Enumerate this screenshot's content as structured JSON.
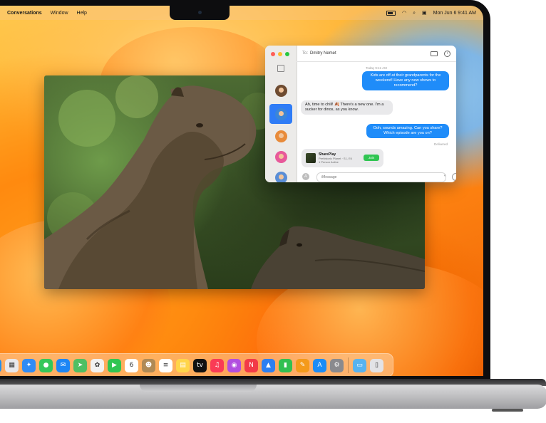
{
  "menubar": {
    "items": [
      "Conversations",
      "Window",
      "Help"
    ],
    "status": {
      "datetime": "Mon Jun 6  9:41 AM"
    }
  },
  "messages": {
    "to_label": "To:",
    "recipient": "Dmitry Nemet",
    "timestamp": "Today 9:41 AM",
    "bubbles": [
      {
        "dir": "out",
        "text": "Kids are off at their grandparents for the weekend! Have any new shows to recommend?"
      },
      {
        "dir": "in",
        "text": "Ah, time to chill! 🍂 There's a new one. I'm a sucker for dinos, as you know."
      },
      {
        "dir": "out",
        "text": "Ooh, sounds amazing. Can you share? Which episode are you on?"
      }
    ],
    "delivered": "Delivered",
    "shareplay": {
      "title": "SharePlay",
      "subtitle": "Prehistoric Planet  ·  S1, E6",
      "subtitle2": "1 Person Active",
      "join_label": "Join"
    },
    "input_placeholder": "iMessage"
  },
  "dock": {
    "apps": [
      {
        "name": "Finder",
        "color": "#1e8ff0",
        "glyph": "☺"
      },
      {
        "name": "Launchpad",
        "color": "#e8e8ec",
        "glyph": "▦"
      },
      {
        "name": "Safari",
        "color": "#2f8bf5",
        "glyph": "✦"
      },
      {
        "name": "Messages",
        "color": "#34c759",
        "glyph": "●"
      },
      {
        "name": "Mail",
        "color": "#1d86f5",
        "glyph": "✉"
      },
      {
        "name": "Maps",
        "color": "#4fbf63",
        "glyph": "➤"
      },
      {
        "name": "Photos",
        "color": "#f2f2f2",
        "glyph": "✿"
      },
      {
        "name": "FaceTime",
        "color": "#30c552",
        "glyph": "▶"
      },
      {
        "name": "Calendar",
        "color": "#ffffff",
        "glyph": "6"
      },
      {
        "name": "Contacts",
        "color": "#b08a55",
        "glyph": "☻"
      },
      {
        "name": "Reminders",
        "color": "#ffffff",
        "glyph": "≡"
      },
      {
        "name": "Notes",
        "color": "#ffd54a",
        "glyph": "▤"
      },
      {
        "name": "TV",
        "color": "#111111",
        "glyph": "tv"
      },
      {
        "name": "Music",
        "color": "#fa3b55",
        "glyph": "♫"
      },
      {
        "name": "Podcasts",
        "color": "#b24ee0",
        "glyph": "◉"
      },
      {
        "name": "News",
        "color": "#f23a48",
        "glyph": "N"
      },
      {
        "name": "Keynote",
        "color": "#2d7ff2",
        "glyph": "▲"
      },
      {
        "name": "Numbers",
        "color": "#31c051",
        "glyph": "▮"
      },
      {
        "name": "Pages",
        "color": "#f49a1b",
        "glyph": "✎"
      },
      {
        "name": "App Store",
        "color": "#1b8cf6",
        "glyph": "A"
      },
      {
        "name": "System Settings",
        "color": "#8a8a8e",
        "glyph": "⚙"
      },
      {
        "name": "Downloads",
        "color": "#58b3f0",
        "glyph": "▭"
      },
      {
        "name": "Trash",
        "color": "#e3e3e6",
        "glyph": "▯"
      }
    ]
  }
}
